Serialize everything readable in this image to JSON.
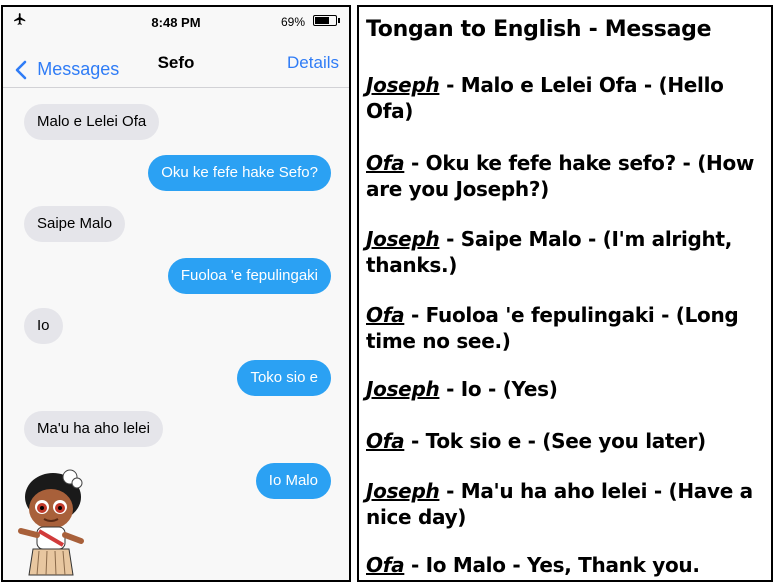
{
  "status_bar": {
    "airplane_icon": "airplane-icon",
    "time": "8:48 PM",
    "battery": "69%",
    "battery_level": 0.69
  },
  "nav": {
    "back_label": "Messages",
    "title": "Sefo",
    "details_label": "Details"
  },
  "messages": [
    {
      "side": "received",
      "text": "Malo e Lelei Ofa"
    },
    {
      "side": "sent",
      "text": "Oku ke fefe hake Sefo?"
    },
    {
      "side": "received",
      "text": "Saipe Malo"
    },
    {
      "side": "sent",
      "text": "Fuoloa 'e fepulingaki"
    },
    {
      "side": "received",
      "text": "Io"
    },
    {
      "side": "sent",
      "text": "Toko sio e"
    },
    {
      "side": "received",
      "text": "Ma'u ha aho lelei"
    },
    {
      "side": "sent",
      "text": "Io Malo"
    }
  ],
  "colors": {
    "sent_bubble": "#2ba1f3",
    "received_bubble": "#e5e5ea",
    "ios_blue": "#2f7cf6"
  },
  "translation": {
    "heading": "Tongan to English - Message",
    "lines": [
      {
        "speaker": "Joseph",
        "text": " - Malo e Lelei Ofa - (Hello Ofa)"
      },
      {
        "speaker": "Ofa",
        "text": " - Oku ke fefe hake sefo? - (How are you Joseph?)"
      },
      {
        "speaker": "Joseph",
        "text": " - Saipe Malo - (I'm alright, thanks.)"
      },
      {
        "speaker": "Ofa",
        "text": " - Fuoloa 'e fepulingaki - (Long time no see.)"
      },
      {
        "speaker": "Joseph",
        "text": " - Io - (Yes)"
      },
      {
        "speaker": "Ofa",
        "text": " - Tok sio e - (See you later)"
      },
      {
        "speaker": "Joseph",
        "text": " - Ma'u ha aho lelei - (Have a nice day)"
      },
      {
        "speaker": "Ofa",
        "text": " - Io Malo - Yes, Thank you."
      }
    ]
  }
}
